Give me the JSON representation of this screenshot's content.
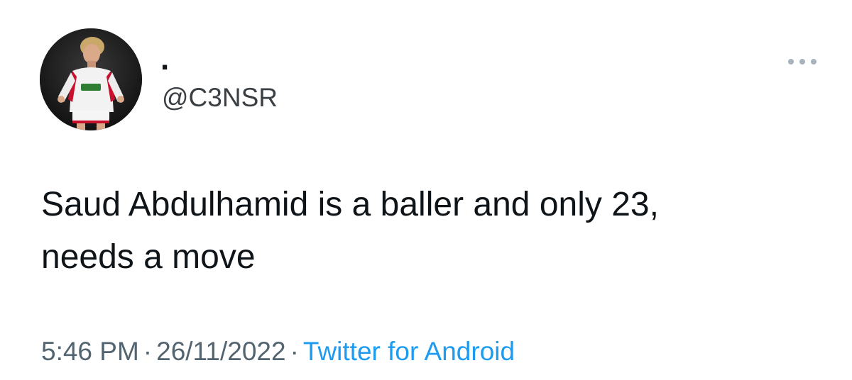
{
  "tweet": {
    "display_name": ".",
    "handle": "@C3NSR",
    "text": "Saud Abdulhamid is a baller and only 23,\nneeds a move",
    "time": "5:46 PM",
    "date": "26/11/2022",
    "separator": "·",
    "source": "Twitter for Android",
    "more_icon": "more-horizontal-icon",
    "avatar_icon": "avatar-photo",
    "colors": {
      "text": "#0f1419",
      "muted": "#536471",
      "link": "#1d9bf0"
    }
  }
}
